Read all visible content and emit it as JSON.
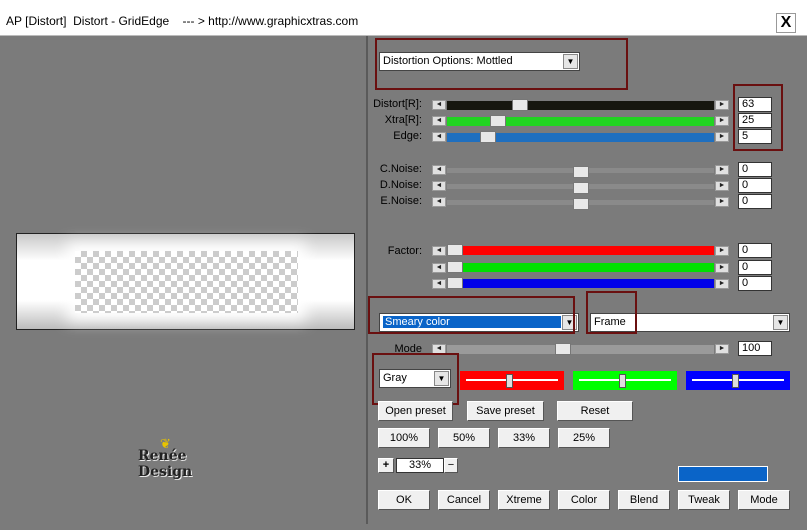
{
  "window": {
    "title": "AP [Distort]  Distort - GridEdge    --- > http://www.graphicxtras.com",
    "close_label": "X"
  },
  "logo": {
    "text": "Renée Design",
    "flower": "❦"
  },
  "distortion": {
    "selected": "Distortion Options: Mottled"
  },
  "sliders": [
    {
      "label": "Distort[R]:",
      "value": "63",
      "color": "#17170f",
      "level": 0.26
    },
    {
      "label": "Xtra[R]:",
      "value": "25",
      "color": "#22d422",
      "level": 0.17
    },
    {
      "label": "Edge:",
      "value": "5",
      "color": "#1f6fbf",
      "level": 0.13
    },
    {
      "label": "C.Noise:",
      "value": "0",
      "color": "#7b7b7b",
      "level": 0.5
    },
    {
      "label": "D.Noise:",
      "value": "0",
      "color": "#7b7b7b",
      "level": 0.5
    },
    {
      "label": "E.Noise:",
      "value": "0",
      "color": "#7b7b7b",
      "level": 0.5
    }
  ],
  "factor": {
    "label": "Factor:",
    "rows": [
      {
        "value": "0",
        "color": "#ff0000"
      },
      {
        "value": "0",
        "color": "#00e000"
      },
      {
        "value": "0",
        "color": "#0000e8"
      }
    ]
  },
  "smeary": {
    "selected": "Smeary color",
    "highlight": "#0a64c8"
  },
  "frame": {
    "selected": "Frame"
  },
  "mode": {
    "label": "Mode",
    "value": "100",
    "level": 0.43
  },
  "gray": {
    "selected": "Gray"
  },
  "swatches": [
    {
      "color": "#ff0000"
    },
    {
      "color": "#00ff00"
    },
    {
      "color": "#0000ff"
    }
  ],
  "presets": {
    "open": "Open preset",
    "save": "Save preset",
    "reset": "Reset"
  },
  "zoom": {
    "z100": "100%",
    "z50": "50%",
    "z33": "33%",
    "z25": "25%",
    "plus": "+",
    "minus": "−",
    "current": "33%"
  },
  "progress_color": "#0a64c8",
  "actions": {
    "ok": "OK",
    "cancel": "Cancel",
    "xtreme": "Xtreme",
    "color": "Color",
    "blend": "Blend",
    "tweak": "Tweak",
    "mode": "Mode"
  }
}
